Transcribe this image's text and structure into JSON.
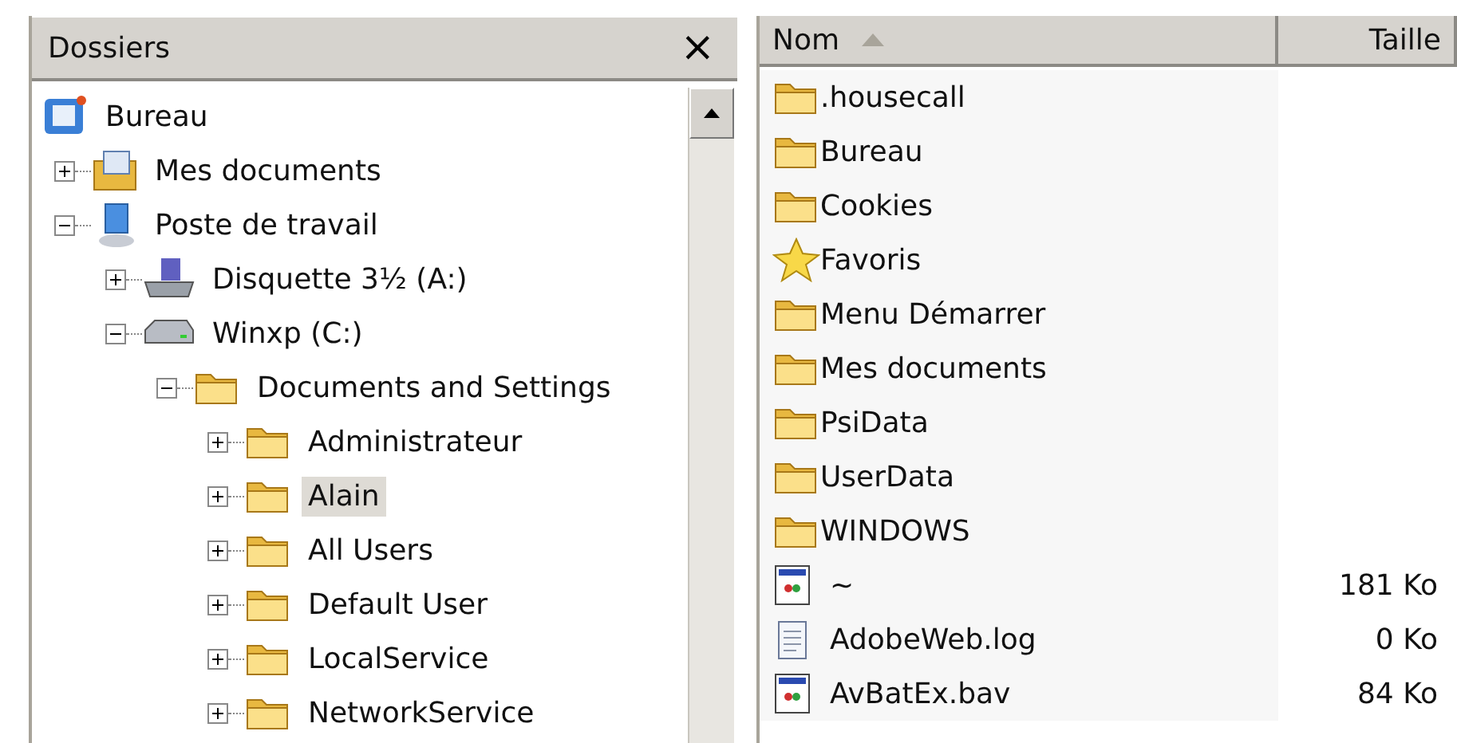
{
  "folders_pane": {
    "title": "Dossiers",
    "close": "×",
    "tree": [
      {
        "label": "Bureau",
        "kind": "desktop",
        "selected": false,
        "children": [
          {
            "label": "Mes documents",
            "kind": "documents",
            "expanded": false,
            "selected": false
          },
          {
            "label": "Poste de travail",
            "kind": "computer",
            "expanded": true,
            "selected": false,
            "children": [
              {
                "label": "Disquette 3½ (A:)",
                "kind": "floppy",
                "expanded": false,
                "selected": false
              },
              {
                "label": "Winxp (C:)",
                "kind": "drive",
                "expanded": true,
                "selected": false,
                "children": [
                  {
                    "label": "Documents and Settings",
                    "kind": "folder",
                    "expanded": true,
                    "selected": false,
                    "children": [
                      {
                        "label": "Administrateur",
                        "kind": "folder",
                        "expanded": false,
                        "selected": false
                      },
                      {
                        "label": "Alain",
                        "kind": "folder",
                        "expanded": false,
                        "selected": true
                      },
                      {
                        "label": "All Users",
                        "kind": "folder",
                        "expanded": false,
                        "selected": false
                      },
                      {
                        "label": "Default User",
                        "kind": "folder",
                        "expanded": false,
                        "selected": false
                      },
                      {
                        "label": "LocalService",
                        "kind": "folder",
                        "expanded": false,
                        "selected": false
                      },
                      {
                        "label": "NetworkService",
                        "kind": "folder",
                        "expanded": false,
                        "selected": false
                      }
                    ]
                  }
                ]
              }
            ]
          }
        ]
      }
    ]
  },
  "file_list": {
    "columns": [
      {
        "label": "Nom",
        "sorted": true
      },
      {
        "label": "Taille",
        "sorted": false
      }
    ],
    "rows": [
      {
        "name": ".housecall",
        "kind": "folder"
      },
      {
        "name": "Bureau",
        "kind": "folder"
      },
      {
        "name": "Cookies",
        "kind": "folder"
      },
      {
        "name": "Favoris",
        "kind": "favorites"
      },
      {
        "name": "Menu Démarrer",
        "kind": "folder"
      },
      {
        "name": "Mes documents",
        "kind": "folder"
      },
      {
        "name": "PsiData",
        "kind": "folder"
      },
      {
        "name": "UserData",
        "kind": "folder"
      },
      {
        "name": "WINDOWS",
        "kind": "folder"
      },
      {
        "name": "~",
        "kind": "app",
        "size": "181 Ko"
      },
      {
        "name": "AdobeWeb.log",
        "kind": "text",
        "size": "0 Ko"
      },
      {
        "name": "AvBatEx.bav",
        "kind": "app",
        "size": "84 Ko"
      }
    ]
  }
}
